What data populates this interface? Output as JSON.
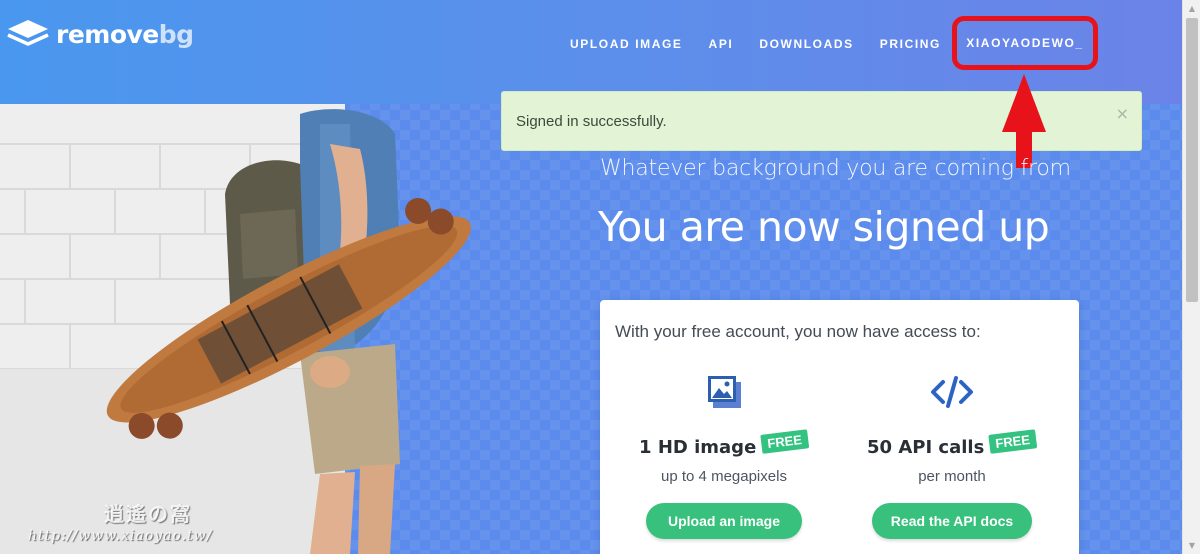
{
  "brand": {
    "name_main": "remove",
    "name_accent": "bg"
  },
  "nav": {
    "items": [
      "UPLOAD IMAGE",
      "API",
      "DOWNLOADS",
      "PRICING"
    ],
    "user": "XIAOYAODEWO_"
  },
  "alert": {
    "message": "Signed in successfully.",
    "close": "×"
  },
  "hero": {
    "subtitle": "Whatever background you are coming from",
    "title": "You are now signed up"
  },
  "card": {
    "intro": "With your free account, you now have access to:",
    "features": [
      {
        "icon": "image-icon",
        "title": "1 HD image",
        "badge": "FREE",
        "sub": "up to 4 megapixels",
        "button": "Upload an image"
      },
      {
        "icon": "code-icon",
        "title": "50 API calls",
        "badge": "FREE",
        "sub": "per month",
        "button": "Read the API docs"
      }
    ]
  },
  "watermark": {
    "top": "逍遙の窩",
    "url": "http://www.xiaoyao.tw/"
  },
  "colors": {
    "accent_green": "#37c17d",
    "highlight_red": "#e8121b",
    "alert_bg": "#e3f3d6",
    "brand_blue": "#4f9af0"
  }
}
